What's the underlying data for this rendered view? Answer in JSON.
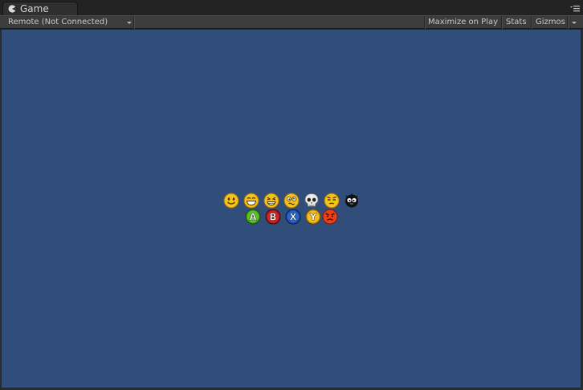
{
  "tab": {
    "title": "Game",
    "icon": "pacman-icon"
  },
  "toolbar": {
    "display_select": "Remote (Not Connected)",
    "maximize_on_play": "Maximize on Play",
    "stats": "Stats",
    "gizmos": "Gizmos"
  },
  "colors": {
    "game_background": "#314d7a",
    "editor_dark": "#2a2a2a",
    "toolbar": "#3c3c3c"
  },
  "sprites": {
    "row1": [
      "smile-emoji-icon",
      "grin-emoji-icon",
      "laugh-emoji-icon",
      "dizzy-emoji-icon",
      "skull-emoji-icon",
      "annoyed-emoji-icon",
      "black-face-emoji-icon"
    ],
    "row2": [
      "A",
      "B",
      "X",
      "Y",
      "angry-emoji-icon"
    ]
  }
}
